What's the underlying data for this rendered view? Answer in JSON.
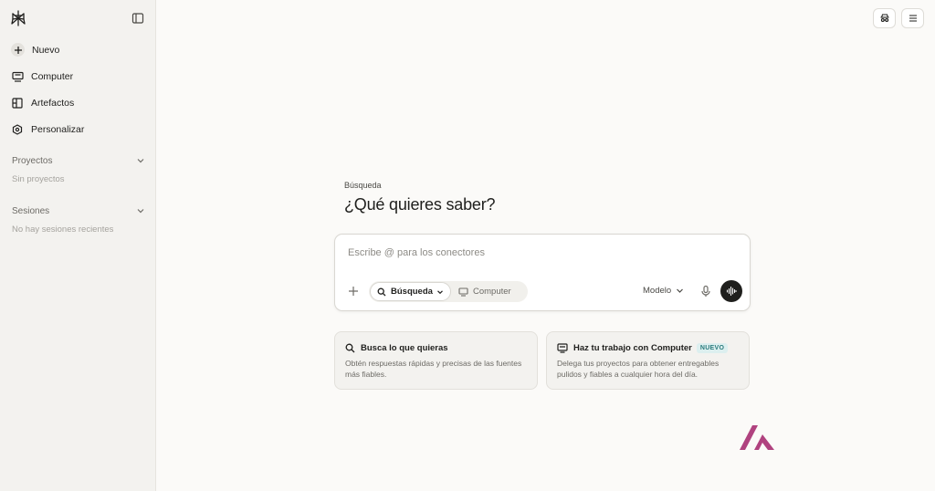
{
  "sidebar": {
    "nav": [
      {
        "label": "Nuevo",
        "icon": "plus-icon"
      },
      {
        "label": "Computer",
        "icon": "monitor-icon"
      },
      {
        "label": "Artefactos",
        "icon": "artifacts-icon"
      },
      {
        "label": "Personalizar",
        "icon": "customize-icon"
      }
    ],
    "projects": {
      "title": "Proyectos",
      "empty": "Sin proyectos"
    },
    "sessions": {
      "title": "Sesiones",
      "empty": "No hay sesiones recientes"
    }
  },
  "main": {
    "label": "Búsqueda",
    "title": "¿Qué quieres saber?",
    "composer": {
      "placeholder": "Escribe @ para los conectores",
      "mode_active": "Búsqueda",
      "mode_inactive": "Computer",
      "model": "Modelo"
    },
    "cards": [
      {
        "title": "Busca lo que quieras",
        "description": "Obtén respuestas rápidas y precisas de las fuentes más fiables.",
        "icon": "search-icon"
      },
      {
        "title": "Haz tu trabajo con Computer",
        "badge": "NUEVO",
        "description": "Delega tus proyectos para obtener entregables pulidos y fiables a cualquier hora del día.",
        "icon": "monitor-icon"
      }
    ]
  },
  "colors": {
    "accent": "#1f1f1d",
    "badge_bg": "#dcefef",
    "badge_text": "#2b7b7c",
    "watermark": "#b0427f"
  }
}
